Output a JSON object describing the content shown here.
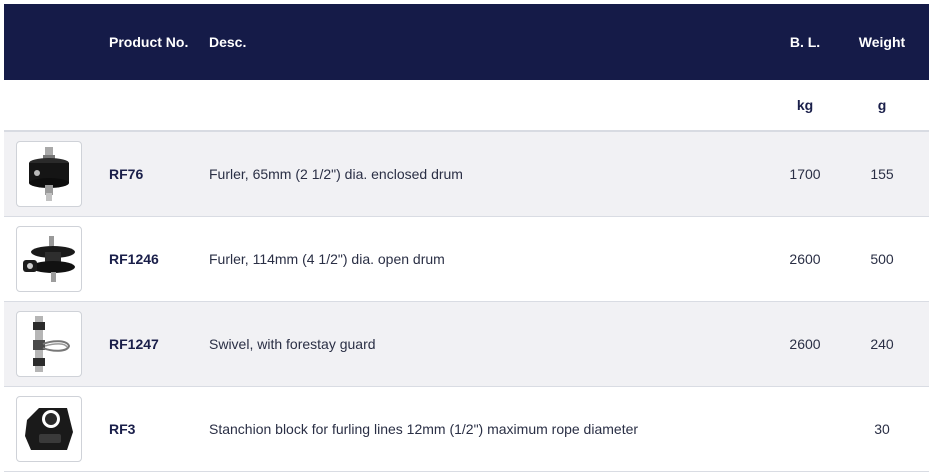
{
  "header": {
    "product_no": "Product No.",
    "desc": "Desc.",
    "bl": "B. L.",
    "weight": "Weight"
  },
  "units": {
    "bl": "kg",
    "weight": "g"
  },
  "rows": [
    {
      "icon": "enclosed-drum-furler-icon",
      "product_no": "RF76",
      "desc": "Furler, 65mm (2 1/2\") dia. enclosed drum",
      "bl": "1700",
      "weight": "155"
    },
    {
      "icon": "open-drum-furler-icon",
      "product_no": "RF1246",
      "desc": "Furler, 114mm (4 1/2\") dia. open drum",
      "bl": "2600",
      "weight": "500"
    },
    {
      "icon": "swivel-forestay-guard-icon",
      "product_no": "RF1247",
      "desc": "Swivel, with forestay guard",
      "bl": "2600",
      "weight": "240"
    },
    {
      "icon": "stanchion-block-icon",
      "product_no": "RF3",
      "desc": "Stanchion block for furling lines 12mm (1/2\") maximum rope diameter",
      "bl": "",
      "weight": "30"
    }
  ],
  "colors": {
    "header_bg": "#151b48",
    "row_alt_bg": "#f1f1f4",
    "text_dark": "#1a1f4a"
  }
}
